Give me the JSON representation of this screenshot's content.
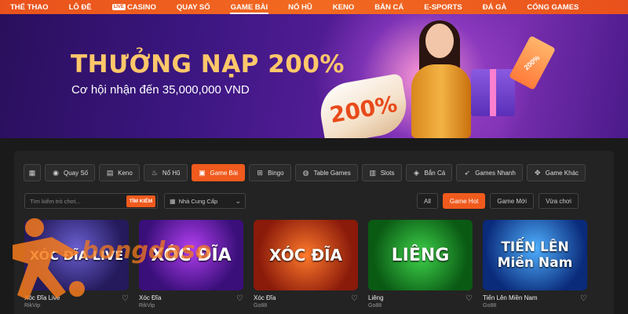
{
  "nav": {
    "items": [
      {
        "label": "THỂ THAO",
        "active": false
      },
      {
        "label": "LÔ ĐỀ",
        "active": false
      },
      {
        "label": "CASINO",
        "active": false,
        "badge": "LIVE"
      },
      {
        "label": "QUAY SỐ",
        "active": false
      },
      {
        "label": "GAME BÀI",
        "active": true
      },
      {
        "label": "NỔ HŨ",
        "active": false
      },
      {
        "label": "KENO",
        "active": false
      },
      {
        "label": "BẮN CÁ",
        "active": false
      },
      {
        "label": "E-SPORTS",
        "active": false
      },
      {
        "label": "ĐÁ GÀ",
        "active": false
      },
      {
        "label": "CỔNG GAMES",
        "active": false
      }
    ]
  },
  "banner": {
    "title": "THƯỞNG NẠP 200%",
    "subtitle": "Cơ hội nhận đến 35,000,000 VND",
    "ribbon_text": "200%",
    "tag_text": "200%"
  },
  "categories": [
    {
      "label": "Quay Số",
      "icon": "ball-icon",
      "active": false
    },
    {
      "label": "Keno",
      "icon": "grid-icon",
      "active": false
    },
    {
      "label": "Nổ Hũ",
      "icon": "pot-icon",
      "active": false
    },
    {
      "label": "Game Bài",
      "icon": "cards-icon",
      "active": true
    },
    {
      "label": "Bingo",
      "icon": "bingo-icon",
      "active": false
    },
    {
      "label": "Table Games",
      "icon": "table-icon",
      "active": false
    },
    {
      "label": "Slots",
      "icon": "slot-icon",
      "active": false
    },
    {
      "label": "Bắn Cá",
      "icon": "fish-icon",
      "active": false
    },
    {
      "label": "Games Nhanh",
      "icon": "rocket-icon",
      "active": false
    },
    {
      "label": "Game Khác",
      "icon": "gamepad-icon",
      "active": false
    }
  ],
  "search": {
    "placeholder": "Tìm kiếm trò chơi...",
    "button": "TÌM KIẾM"
  },
  "provider": {
    "label": "Nhà Cung Cấp"
  },
  "filters": [
    {
      "label": "All",
      "active": false
    },
    {
      "label": "Game Hot",
      "active": true
    },
    {
      "label": "Game Mới",
      "active": false
    },
    {
      "label": "Vừa chơi",
      "active": false
    }
  ],
  "games": [
    {
      "name": "Xóc Đĩa Live",
      "provider": "RikVip",
      "art": "XÓC ĐĨA LIVE"
    },
    {
      "name": "Xóc Đĩa",
      "provider": "RikVip",
      "art": "XÓC ĐĨA"
    },
    {
      "name": "Xóc Đĩa",
      "provider": "Go88",
      "art": "XÓC ĐĨA"
    },
    {
      "name": "Liêng",
      "provider": "Go88",
      "art": "LIÊNG"
    },
    {
      "name": "Tiến Lên Miền Nam",
      "provider": "Go88",
      "art": "TIẾN LÊN Miền Nam"
    }
  ],
  "watermark": {
    "text": "bongdaso"
  },
  "colors": {
    "accent": "#f05a1d",
    "background": "#1a1a1a",
    "banner_gold": "#ffc76a"
  }
}
